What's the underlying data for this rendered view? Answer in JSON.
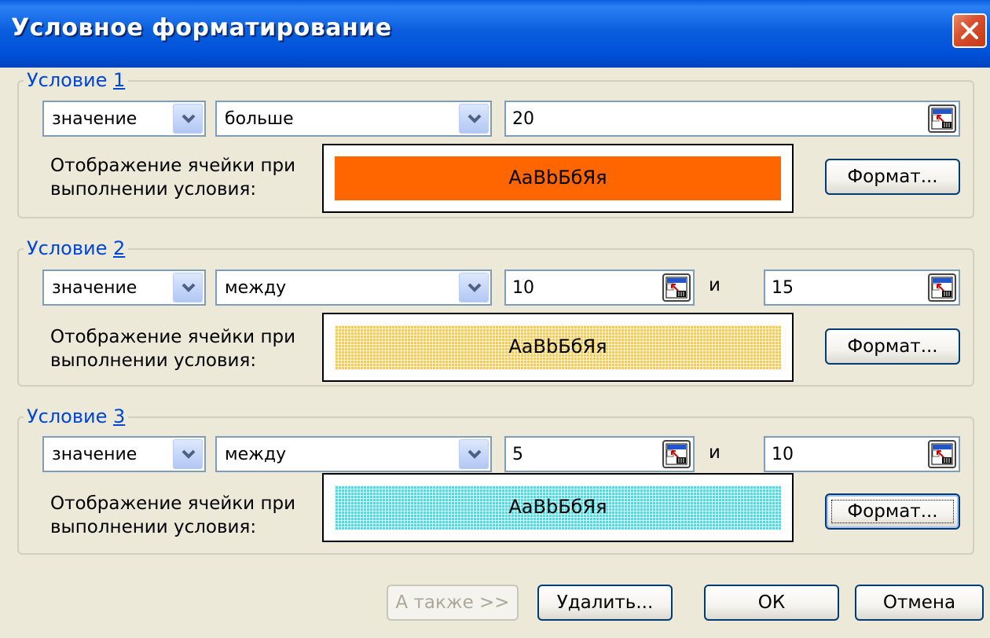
{
  "dialog": {
    "title": "Условное форматирование",
    "close_icon": "close-icon"
  },
  "conditions": [
    {
      "legend_prefix": "Условие ",
      "legend_num": "1",
      "type_value": "значение",
      "operator_value": "больше",
      "value1": "20",
      "value2": null,
      "connector": null,
      "preview_label": [
        "Отображение ячейки при",
        "выполнении условия:"
      ],
      "sample_text": "АaBbБбЯя",
      "format_button": "Формат...",
      "fill_color": "#ff6600",
      "fill_pattern": "solid"
    },
    {
      "legend_prefix": "Условие ",
      "legend_num": "2",
      "type_value": "значение",
      "operator_value": "между",
      "value1": "10",
      "value2": "15",
      "connector": "и",
      "preview_label": [
        "Отображение ячейки при",
        "выполнении условия:"
      ],
      "sample_text": "АaBbБбЯя",
      "format_button": "Формат...",
      "fill_color": "#ffcc33",
      "fill_pattern": "grid"
    },
    {
      "legend_prefix": "Условие ",
      "legend_num": "3",
      "type_value": "значение",
      "operator_value": "между",
      "value1": "5",
      "value2": "10",
      "connector": "и",
      "preview_label": [
        "Отображение ячейки при",
        "выполнении условия:"
      ],
      "sample_text": "АaBbБбЯя",
      "format_button": "Формат...",
      "fill_color": "#33e6f0",
      "fill_pattern": "grid"
    }
  ],
  "buttons": {
    "also": "А также >>",
    "delete": "Удалить...",
    "ok": "ОК",
    "cancel": "Отмена"
  },
  "colors": {
    "titlebar": "#0050d8",
    "legend_text": "#0046d5",
    "dialog_bg": "#ece9d8"
  },
  "icons": {
    "dropdown": "chevron-down-icon",
    "range_select": "collapse-dialog-icon"
  }
}
